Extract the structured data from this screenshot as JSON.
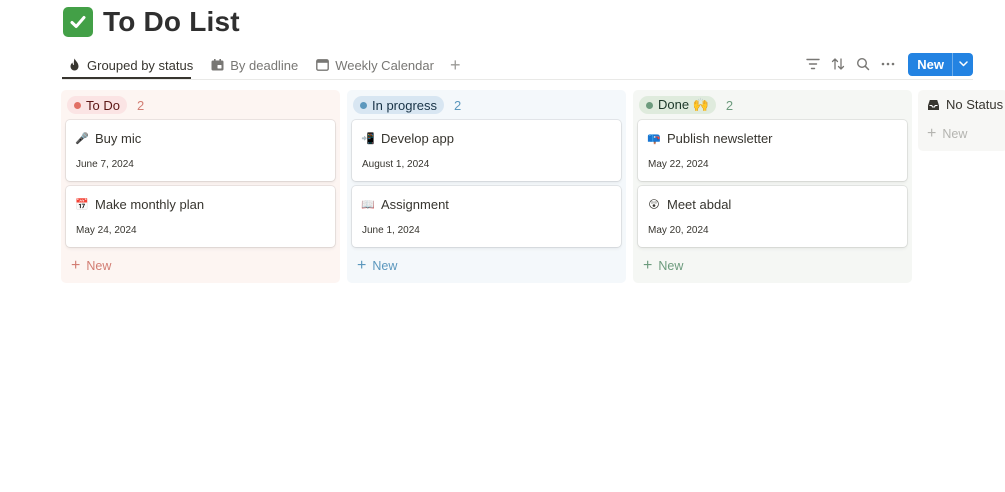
{
  "page": {
    "title": "To Do List",
    "title_icon": "green-check-emoji"
  },
  "tabs": [
    {
      "label": "Grouped by status",
      "icon": "flame-icon",
      "active": true
    },
    {
      "label": "By deadline",
      "icon": "calendar-folder-icon",
      "active": false
    },
    {
      "label": "Weekly Calendar",
      "icon": "calendar-icon",
      "active": false
    }
  ],
  "tab_add": "+",
  "toolbar": {
    "icons": [
      "filter-icon",
      "sort-icon",
      "search-icon",
      "more-icon"
    ],
    "new_label": "New"
  },
  "columns": [
    {
      "label": "To Do",
      "count": "2",
      "colors": {
        "bg": "#fdf5f2",
        "pill": "#fbe4e4",
        "dot": "#e16f64",
        "text": "#5d1715",
        "count": "#d27d73",
        "new": "#d27d73"
      },
      "cards": [
        {
          "title": "Buy mic",
          "date": "June 7, 2024",
          "emoji": "🎤"
        },
        {
          "title": "Make monthly plan",
          "date": "May 24, 2024",
          "emoji": "📅"
        }
      ],
      "new_label": "New"
    },
    {
      "label": "In progress",
      "count": "2",
      "colors": {
        "bg": "#f4f8fb",
        "pill": "#d8e6f2",
        "dot": "#5b97bd",
        "text": "#183347",
        "count": "#5b97bd",
        "new": "#5b97bd"
      },
      "cards": [
        {
          "title": "Develop app",
          "date": "August 1, 2024",
          "emoji": "📲"
        },
        {
          "title": "Assignment",
          "date": "June 1, 2024",
          "emoji": "📖"
        }
      ],
      "new_label": "New"
    },
    {
      "label": "Done 🙌",
      "count": "2",
      "colors": {
        "bg": "#f5f7f4",
        "pill": "#dfebdd",
        "dot": "#6c9b7d",
        "text": "#1c3829",
        "count": "#6c9b7d",
        "new": "#6c9b7d"
      },
      "cards": [
        {
          "title": "Publish newsletter",
          "date": "May 22, 2024",
          "emoji": "📪"
        },
        {
          "title": "Meet abdal",
          "date": "May 20, 2024",
          "emoji": "😲"
        }
      ],
      "new_label": "New"
    }
  ],
  "no_status": {
    "label": "No Status",
    "new_label": "New",
    "icon": "inbox-icon"
  }
}
